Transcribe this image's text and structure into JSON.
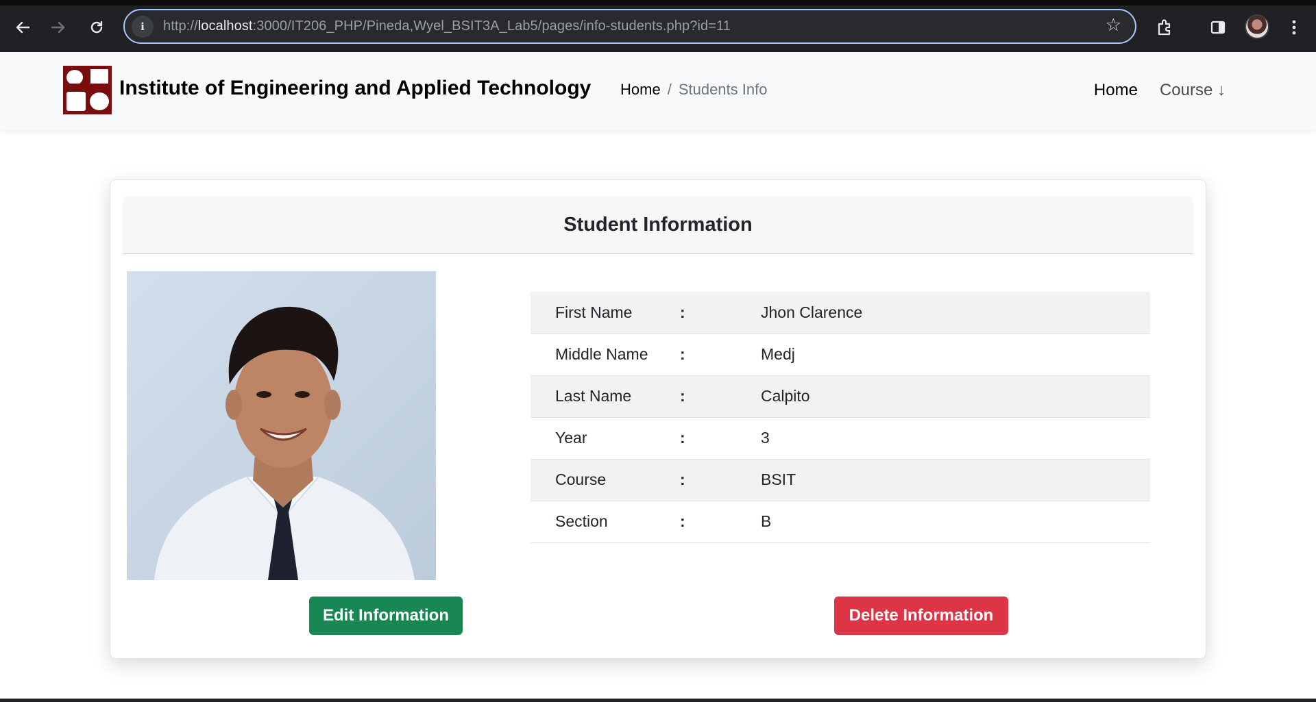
{
  "browser": {
    "url_prefix": "http://",
    "url_host": "localhost",
    "url_rest": ":3000/IT206_PHP/Pineda,Wyel_BSIT3A_Lab5/pages/info-students.php?id=11",
    "icons": [
      "back-icon",
      "forward-icon",
      "reload-icon",
      "site-info-icon",
      "star-icon",
      "extensions-icon",
      "side-panel-icon",
      "profile-avatar",
      "more-menu-icon"
    ]
  },
  "navbar": {
    "brand": "Institute of Engineering and Applied Technology",
    "breadcrumb": {
      "home": "Home",
      "separator": "/",
      "active": "Students Info"
    },
    "links": {
      "home": "Home",
      "course": "Course ↓"
    }
  },
  "card": {
    "title": "Student Information",
    "fields": [
      {
        "label": "First Name",
        "colon": ":",
        "value": "Jhon Clarence"
      },
      {
        "label": "Middle Name",
        "colon": ":",
        "value": "Medj"
      },
      {
        "label": "Last Name",
        "colon": ":",
        "value": "Calpito"
      },
      {
        "label": "Year",
        "colon": ":",
        "value": "3"
      },
      {
        "label": "Course",
        "colon": ":",
        "value": "BSIT"
      },
      {
        "label": "Section",
        "colon": ":",
        "value": "B"
      }
    ],
    "edit_label": "Edit Information",
    "delete_label": "Delete Information"
  },
  "colors": {
    "brand_maroon": "#7a0d0d",
    "edit_green": "#198754",
    "delete_red": "#dc3545",
    "chrome_dark": "#202124",
    "omnibox_focus": "#a8c7fa"
  }
}
